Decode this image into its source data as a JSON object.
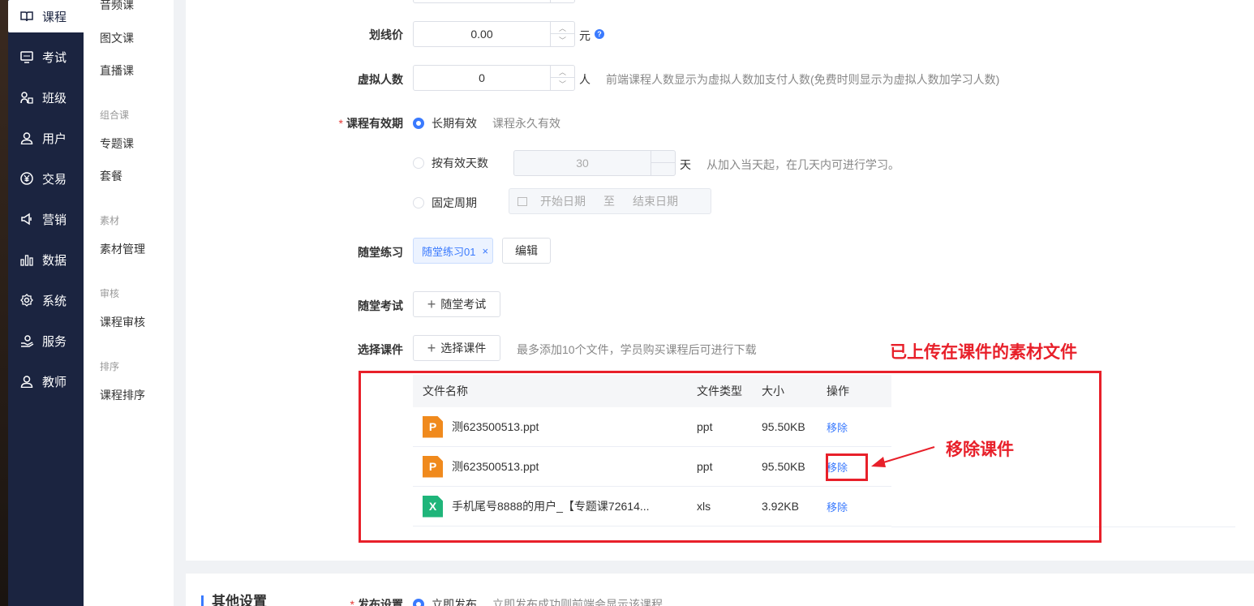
{
  "nav": {
    "items": [
      {
        "label": "课程",
        "icon": "book-icon",
        "active": true
      },
      {
        "label": "考试",
        "icon": "exam-icon"
      },
      {
        "label": "班级",
        "icon": "class-icon"
      },
      {
        "label": "用户",
        "icon": "user-icon"
      },
      {
        "label": "交易",
        "icon": "yen-icon"
      },
      {
        "label": "营销",
        "icon": "megaphone-icon"
      },
      {
        "label": "数据",
        "icon": "bar-chart-icon"
      },
      {
        "label": "系统",
        "icon": "gear-icon"
      },
      {
        "label": "服务",
        "icon": "service-icon"
      },
      {
        "label": "教师",
        "icon": "teacher-icon"
      }
    ]
  },
  "submenu": {
    "items": {
      "audio": "音频课",
      "imgtext": "图文课",
      "live": "直播课",
      "group_combo": "组合课",
      "topic": "专题课",
      "package": "套餐",
      "group_material": "素材",
      "material_manage": "素材管理",
      "group_review": "审核",
      "course_review": "课程审核",
      "group_sort": "排序",
      "course_sort": "课程排序"
    }
  },
  "form": {
    "strike_price": {
      "label": "划线价",
      "value": "0.00",
      "unit": "元"
    },
    "virtual_count": {
      "label": "虚拟人数",
      "value": "0",
      "unit": "人",
      "hint": "前端课程人数显示为虚拟人数加支付人数(免费时则显示为虚拟人数加学习人数)"
    },
    "validity": {
      "required": "*",
      "label": "课程有效期",
      "opt_long": "长期有效",
      "opt_long_hint": "课程永久有效",
      "opt_days": "按有效天数",
      "days_value": "30",
      "days_unit": "天",
      "days_hint": "从加入当天起，在几天内可进行学习。",
      "opt_fixed": "固定周期",
      "start_placeholder": "开始日期",
      "to": "至",
      "end_placeholder": "结束日期"
    },
    "practice": {
      "label": "随堂练习",
      "tag": "随堂练习01",
      "tag_close": "×",
      "edit": "编辑"
    },
    "exam": {
      "label": "随堂考试",
      "button": "随堂考试"
    },
    "courseware": {
      "label": "选择课件",
      "button": "选择课件",
      "hint": "最多添加10个文件，学员购买课程后可进行下载"
    }
  },
  "table": {
    "headers": [
      "文件名称",
      "文件类型",
      "大小",
      "操作"
    ],
    "rows": [
      {
        "icon": "ppt-file-icon",
        "letter": "P",
        "name": "测623500513.ppt",
        "type": "ppt",
        "size": "95.50KB",
        "action": "移除"
      },
      {
        "icon": "ppt-file-icon",
        "letter": "P",
        "name": "测623500513.ppt",
        "type": "ppt",
        "size": "95.50KB",
        "action": "移除"
      },
      {
        "icon": "xls-file-icon",
        "letter": "X",
        "name": "手机尾号8888的用户_【专题课72614...",
        "type": "xls",
        "size": "3.92KB",
        "action": "移除"
      }
    ]
  },
  "annotations": {
    "uploaded": "已上传在课件的素材文件",
    "remove": "移除课件"
  },
  "section2": {
    "title": "其他设置",
    "required": "*",
    "publish_label": "发布设置",
    "publish_opt": "立即发布",
    "publish_hint": "立即发布成功则前端会显示该课程"
  },
  "colors": {
    "nav_bg": "#1b2440",
    "accent": "#3a7afe",
    "annotation": "#e8202a"
  }
}
